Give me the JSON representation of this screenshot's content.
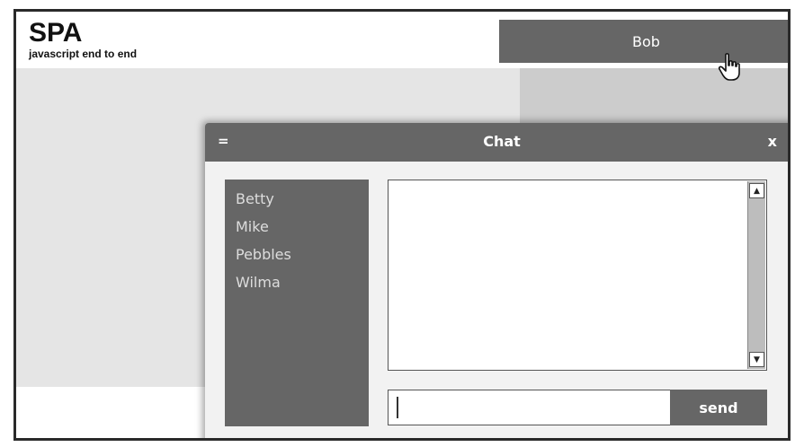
{
  "header": {
    "logo_title": "SPA",
    "logo_subtitle": "javascript end to end",
    "user_label": "Bob"
  },
  "chat": {
    "menu_label": "=",
    "title": "Chat",
    "close_label": "x",
    "roster": [
      "Betty",
      "Mike",
      "Pebbles",
      "Wilma"
    ],
    "input": {
      "value": "",
      "placeholder": ""
    },
    "send_label": "send"
  },
  "colors": {
    "panel_dark": "#666666",
    "content_light": "#e5e5e5",
    "content_mid": "#cccccc"
  }
}
